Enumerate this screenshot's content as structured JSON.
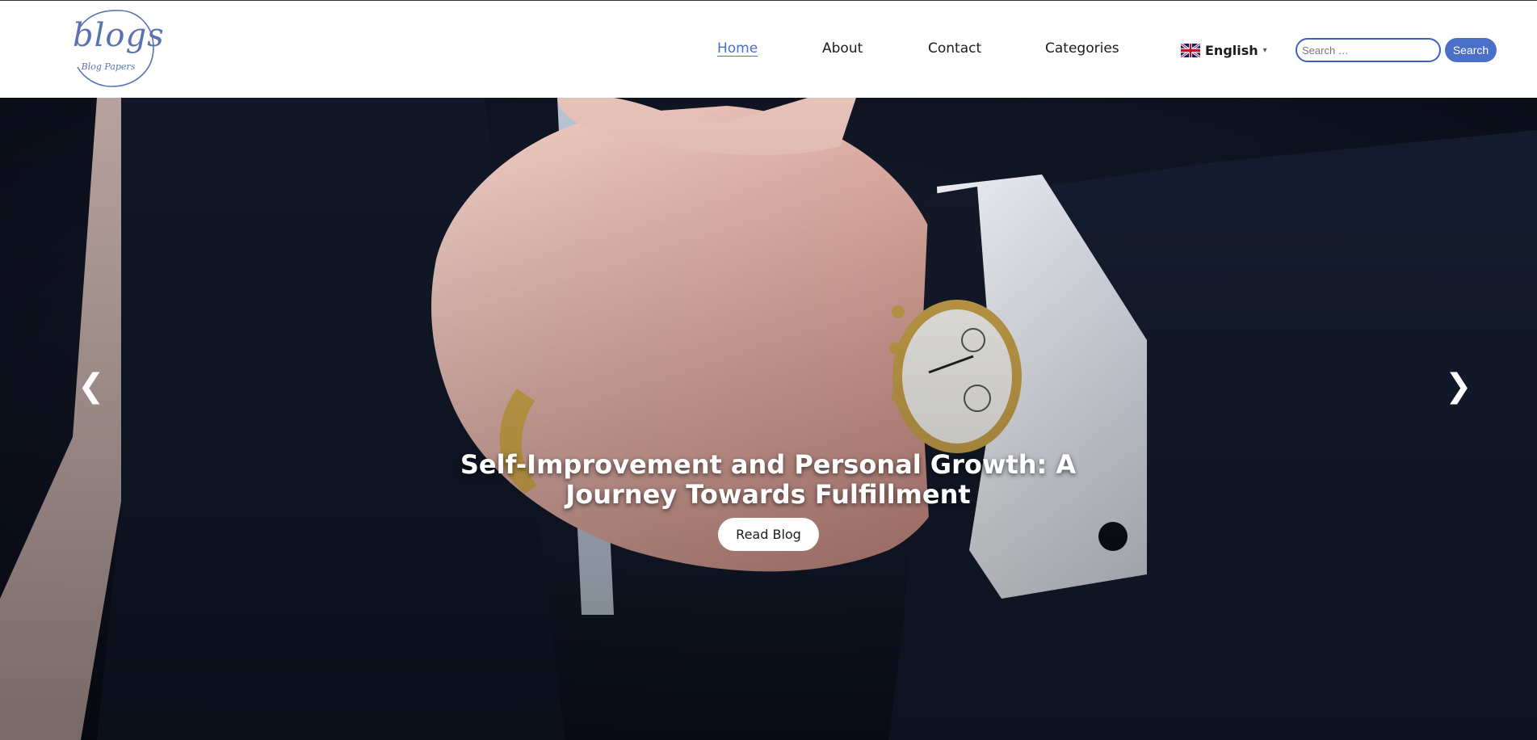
{
  "header": {
    "logo": {
      "main": "blogs",
      "sub": "Blog Papers"
    },
    "nav": [
      {
        "label": "Home",
        "active": true
      },
      {
        "label": "About",
        "active": false
      },
      {
        "label": "Contact",
        "active": false
      },
      {
        "label": "Categories",
        "active": false
      }
    ],
    "language": {
      "label": "English",
      "flag_icon": "uk-flag-icon",
      "caret_icon": "caret-down-icon"
    },
    "search": {
      "placeholder": "Search …",
      "button_label": "Search"
    }
  },
  "hero": {
    "title": "Self-Improvement and Personal Growth: A Journey Towards Fulfillment",
    "button_label": "Read Blog",
    "prev_glyph": "❮",
    "next_glyph": "❯"
  },
  "colors": {
    "accent": "#4a6fc7",
    "search_border": "#3f60bf",
    "logo": "#5a73b0",
    "hero_dark": "#0f1424"
  }
}
